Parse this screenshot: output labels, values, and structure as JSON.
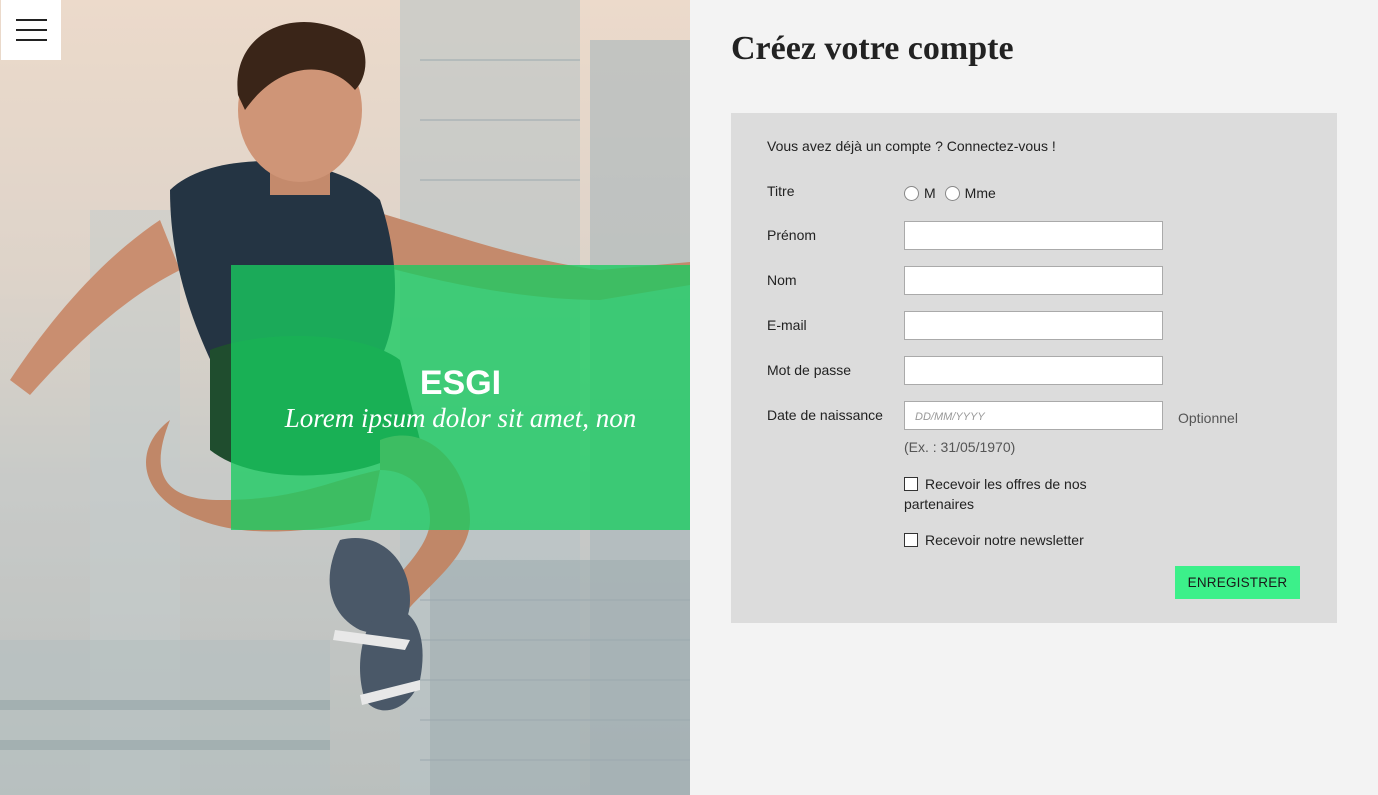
{
  "hero": {
    "brand": "ESGI",
    "tagline": "Lorem ipsum dolor sit amet, non"
  },
  "menu": {
    "icon": "hamburger-icon"
  },
  "form": {
    "title": "Créez votre compte",
    "login_link": "Vous avez déjà un compte ? Connectez-vous !",
    "titre_label": "Titre",
    "titre_options": [
      "M",
      "Mme"
    ],
    "prenom_label": "Prénom",
    "nom_label": "Nom",
    "email_label": "E-mail",
    "password_label": "Mot de passe",
    "birthdate_label": "Date de naissance",
    "birthdate_placeholder": "DD/MM/YYYY",
    "optional_label": "Optionnel",
    "birthdate_example": "(Ex. : 31/05/1970)",
    "offers_label": "Recevoir les offres de nos partenaires",
    "newsletter_label": "Recevoir notre newsletter",
    "submit_label": "ENREGISTRER"
  },
  "colors": {
    "accent": "#3cf08a",
    "overlay": "#18cc60",
    "card": "#dcdcdc",
    "background": "#f3f3f3"
  }
}
